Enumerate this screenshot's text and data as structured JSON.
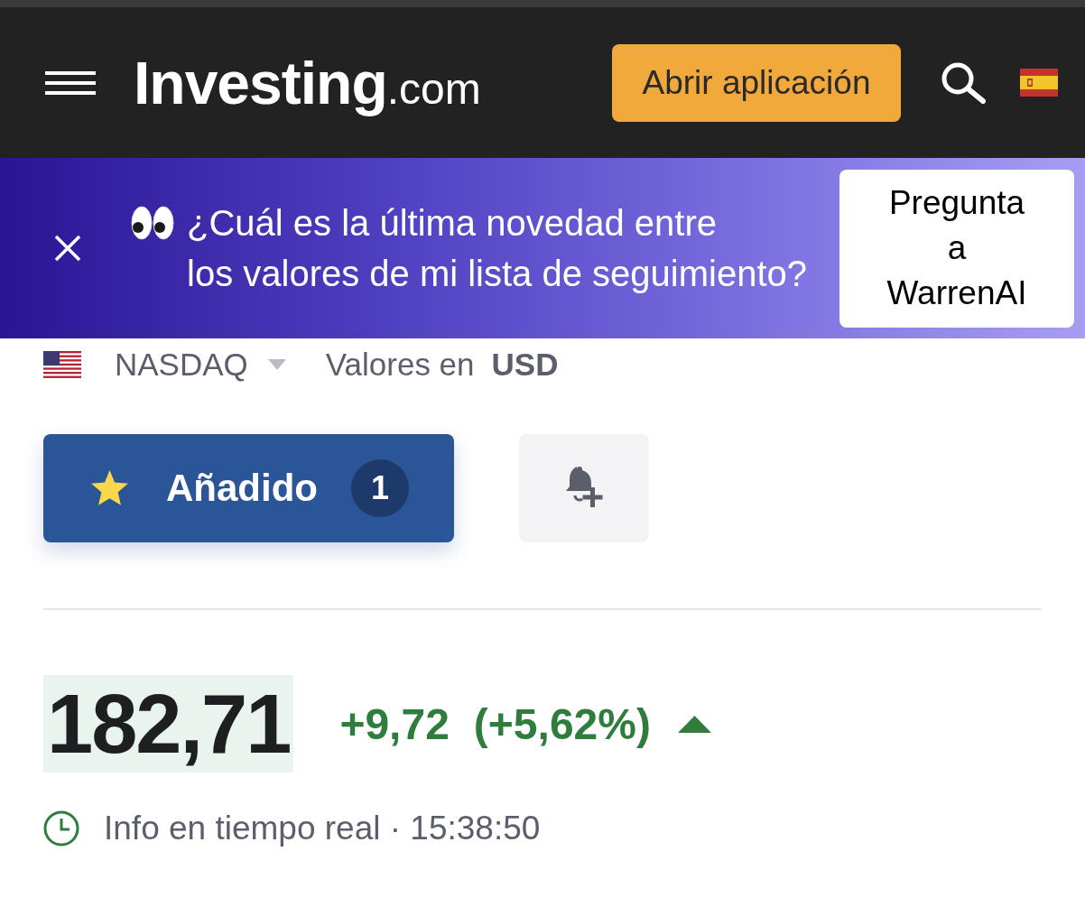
{
  "header": {
    "logo": {
      "name": "Investing",
      "suffix": ".com"
    },
    "open_app_button": "Abrir aplicación"
  },
  "banner": {
    "message_lines": [
      "¿Cuál es la última novedad entre",
      "los valores de mi lista de seguimiento?"
    ],
    "action": "Pregunta a WarrenAI"
  },
  "market": {
    "exchange": "NASDAQ",
    "currency_label": "Valores en",
    "currency": "USD"
  },
  "watchlist": {
    "label": "Añadido",
    "count": "1"
  },
  "quote": {
    "price": "182,71",
    "change": "+9,72",
    "change_percent": "(+5,62%)",
    "rising": true,
    "status": "Info en tiempo real · 15:38:50"
  }
}
